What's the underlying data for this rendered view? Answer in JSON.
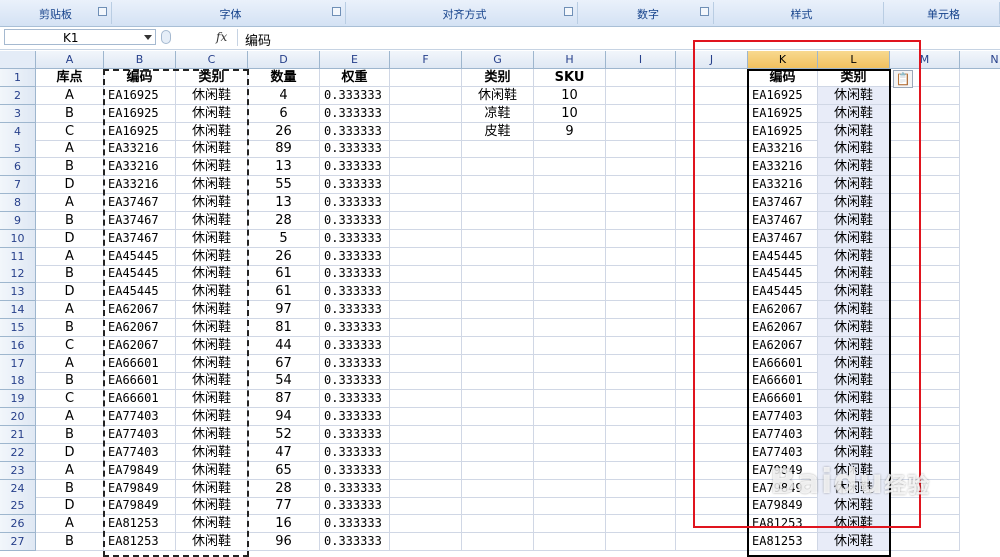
{
  "ribbon": {
    "groups": [
      {
        "label": "剪贴板",
        "launcher": true
      },
      {
        "label": "字体",
        "launcher": true
      },
      {
        "label": "对齐方式",
        "launcher": true
      },
      {
        "label": "数字",
        "launcher": true
      },
      {
        "label": "样式",
        "launcher": false
      },
      {
        "label": "单元格",
        "launcher": false
      }
    ]
  },
  "formula_bar": {
    "name_box": "K1",
    "fx": "fx",
    "value": "编码"
  },
  "columns": [
    "A",
    "B",
    "C",
    "D",
    "E",
    "F",
    "G",
    "H",
    "I",
    "J",
    "K",
    "L",
    "M",
    "N"
  ],
  "selected_columns": [
    "K",
    "L"
  ],
  "rows": [
    {
      "n": "1",
      "A": "库点",
      "B": "编码",
      "C": "类别",
      "D": "数量",
      "E": "权重",
      "G": "类别",
      "H": "SKU",
      "K": "编码",
      "L": "类别"
    },
    {
      "n": "2",
      "A": "A",
      "B": "EA16925",
      "C": "休闲鞋",
      "D": "4",
      "E": "0.333333",
      "G": "休闲鞋",
      "H": "10",
      "K": "EA16925",
      "L": "休闲鞋"
    },
    {
      "n": "3",
      "A": "B",
      "B": "EA16925",
      "C": "休闲鞋",
      "D": "6",
      "E": "0.333333",
      "G": "凉鞋",
      "H": "10",
      "K": "EA16925",
      "L": "休闲鞋"
    },
    {
      "n": "4",
      "A": "C",
      "B": "EA16925",
      "C": "休闲鞋",
      "D": "26",
      "E": "0.333333",
      "G": "皮鞋",
      "H": "9",
      "K": "EA16925",
      "L": "休闲鞋"
    },
    {
      "n": "5",
      "A": "A",
      "B": "EA33216",
      "C": "休闲鞋",
      "D": "89",
      "E": "0.333333",
      "K": "EA33216",
      "L": "休闲鞋"
    },
    {
      "n": "6",
      "A": "B",
      "B": "EA33216",
      "C": "休闲鞋",
      "D": "13",
      "E": "0.333333",
      "K": "EA33216",
      "L": "休闲鞋"
    },
    {
      "n": "7",
      "A": "D",
      "B": "EA33216",
      "C": "休闲鞋",
      "D": "55",
      "E": "0.333333",
      "K": "EA33216",
      "L": "休闲鞋"
    },
    {
      "n": "8",
      "A": "A",
      "B": "EA37467",
      "C": "休闲鞋",
      "D": "13",
      "E": "0.333333",
      "K": "EA37467",
      "L": "休闲鞋"
    },
    {
      "n": "9",
      "A": "B",
      "B": "EA37467",
      "C": "休闲鞋",
      "D": "28",
      "E": "0.333333",
      "K": "EA37467",
      "L": "休闲鞋"
    },
    {
      "n": "10",
      "A": "D",
      "B": "EA37467",
      "C": "休闲鞋",
      "D": "5",
      "E": "0.333333",
      "K": "EA37467",
      "L": "休闲鞋"
    },
    {
      "n": "11",
      "A": "A",
      "B": "EA45445",
      "C": "休闲鞋",
      "D": "26",
      "E": "0.333333",
      "K": "EA45445",
      "L": "休闲鞋"
    },
    {
      "n": "12",
      "A": "B",
      "B": "EA45445",
      "C": "休闲鞋",
      "D": "61",
      "E": "0.333333",
      "K": "EA45445",
      "L": "休闲鞋"
    },
    {
      "n": "13",
      "A": "D",
      "B": "EA45445",
      "C": "休闲鞋",
      "D": "61",
      "E": "0.333333",
      "K": "EA45445",
      "L": "休闲鞋"
    },
    {
      "n": "14",
      "A": "A",
      "B": "EA62067",
      "C": "休闲鞋",
      "D": "97",
      "E": "0.333333",
      "K": "EA62067",
      "L": "休闲鞋"
    },
    {
      "n": "15",
      "A": "B",
      "B": "EA62067",
      "C": "休闲鞋",
      "D": "81",
      "E": "0.333333",
      "K": "EA62067",
      "L": "休闲鞋"
    },
    {
      "n": "16",
      "A": "C",
      "B": "EA62067",
      "C": "休闲鞋",
      "D": "44",
      "E": "0.333333",
      "K": "EA62067",
      "L": "休闲鞋"
    },
    {
      "n": "17",
      "A": "A",
      "B": "EA66601",
      "C": "休闲鞋",
      "D": "67",
      "E": "0.333333",
      "K": "EA66601",
      "L": "休闲鞋"
    },
    {
      "n": "18",
      "A": "B",
      "B": "EA66601",
      "C": "休闲鞋",
      "D": "54",
      "E": "0.333333",
      "K": "EA66601",
      "L": "休闲鞋"
    },
    {
      "n": "19",
      "A": "C",
      "B": "EA66601",
      "C": "休闲鞋",
      "D": "87",
      "E": "0.333333",
      "K": "EA66601",
      "L": "休闲鞋"
    },
    {
      "n": "20",
      "A": "A",
      "B": "EA77403",
      "C": "休闲鞋",
      "D": "94",
      "E": "0.333333",
      "K": "EA77403",
      "L": "休闲鞋"
    },
    {
      "n": "21",
      "A": "B",
      "B": "EA77403",
      "C": "休闲鞋",
      "D": "52",
      "E": "0.333333",
      "K": "EA77403",
      "L": "休闲鞋"
    },
    {
      "n": "22",
      "A": "D",
      "B": "EA77403",
      "C": "休闲鞋",
      "D": "47",
      "E": "0.333333",
      "K": "EA77403",
      "L": "休闲鞋"
    },
    {
      "n": "23",
      "A": "A",
      "B": "EA79849",
      "C": "休闲鞋",
      "D": "65",
      "E": "0.333333",
      "K": "EA79849",
      "L": "休闲鞋"
    },
    {
      "n": "24",
      "A": "B",
      "B": "EA79849",
      "C": "休闲鞋",
      "D": "28",
      "E": "0.333333",
      "K": "EA79849",
      "L": "休闲鞋"
    },
    {
      "n": "25",
      "A": "D",
      "B": "EA79849",
      "C": "休闲鞋",
      "D": "77",
      "E": "0.333333",
      "K": "EA79849",
      "L": "休闲鞋"
    },
    {
      "n": "26",
      "A": "A",
      "B": "EA81253",
      "C": "休闲鞋",
      "D": "16",
      "E": "0.333333",
      "K": "EA81253",
      "L": "休闲鞋"
    },
    {
      "n": "27",
      "A": "B",
      "B": "EA81253",
      "C": "休闲鞋",
      "D": "96",
      "E": "0.333333",
      "K": "EA81253",
      "L": "休闲鞋"
    }
  ],
  "paste_options_icon": "clipboard-icon",
  "watermark": {
    "text": "Baidu",
    "suffix": "经验"
  },
  "colors": {
    "selection_outline": "#000000",
    "highlight_box": "#e0141e",
    "selected_header": "#f1c15f"
  }
}
